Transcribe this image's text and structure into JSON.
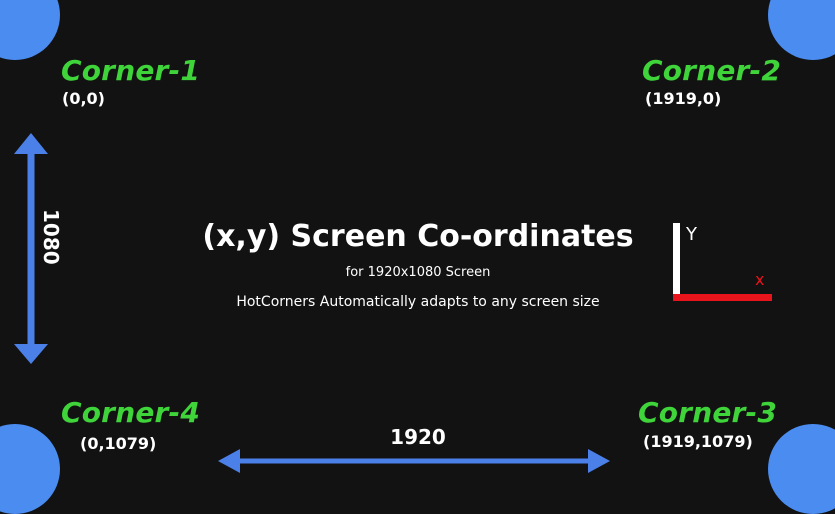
{
  "title": "(x,y) Screen Co-ordinates",
  "subtitle": "for 1920x1080 Screen",
  "note": "HotCorners Automatically adapts to any screen size",
  "corners": [
    {
      "name": "Corner-1",
      "coord": "(0,0)"
    },
    {
      "name": "Corner-2",
      "coord": "(1919,0)"
    },
    {
      "name": "Corner-3",
      "coord": "(1919,1079)"
    },
    {
      "name": "Corner-4",
      "coord": "(0,1079)"
    }
  ],
  "dimensions": {
    "width": "1920",
    "height": "1080"
  },
  "axes": {
    "y": "Y",
    "x": "x"
  },
  "colors": {
    "background": "#121212",
    "corner_blob": "#4a8cf0",
    "corner_label": "#3ed43a",
    "arrow": "#4a80e8",
    "x_axis": "#e8141c",
    "y_axis": "#ffffff",
    "text": "#ffffff"
  }
}
